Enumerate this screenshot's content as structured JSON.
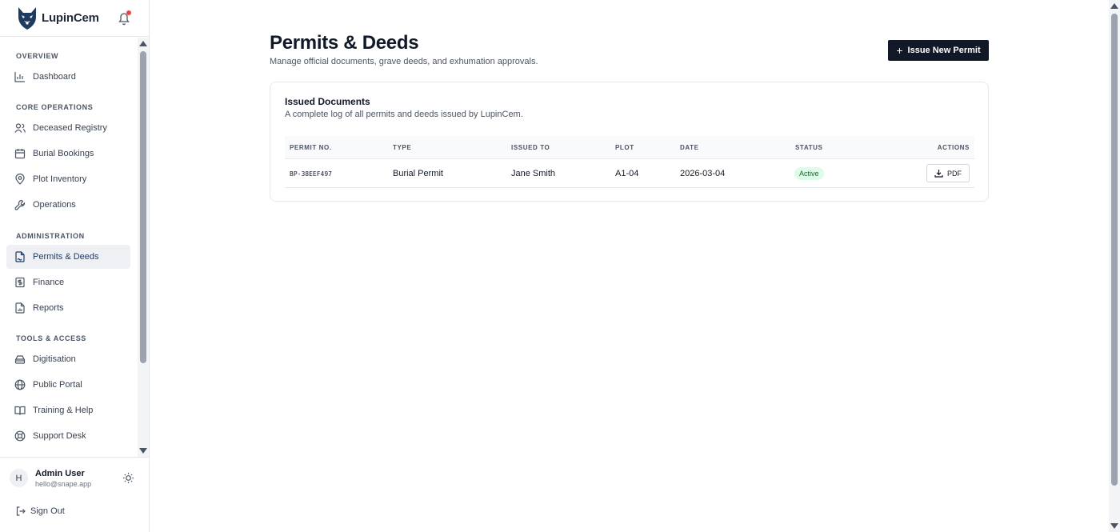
{
  "brand": {
    "name": "LupinCem"
  },
  "sidebar": {
    "sections": [
      {
        "title": "OVERVIEW",
        "items": [
          {
            "label": "Dashboard",
            "icon": "bar-chart-icon"
          }
        ]
      },
      {
        "title": "CORE OPERATIONS",
        "items": [
          {
            "label": "Deceased Registry",
            "icon": "users-icon"
          },
          {
            "label": "Burial Bookings",
            "icon": "calendar-icon"
          },
          {
            "label": "Plot Inventory",
            "icon": "map-pin-icon"
          },
          {
            "label": "Operations",
            "icon": "wrench-icon"
          }
        ]
      },
      {
        "title": "ADMINISTRATION",
        "items": [
          {
            "label": "Permits & Deeds",
            "icon": "file-signature-icon",
            "active": true
          },
          {
            "label": "Finance",
            "icon": "receipt-icon"
          },
          {
            "label": "Reports",
            "icon": "file-chart-icon"
          }
        ]
      },
      {
        "title": "TOOLS & ACCESS",
        "items": [
          {
            "label": "Digitisation",
            "icon": "scanner-icon"
          },
          {
            "label": "Public Portal",
            "icon": "globe-icon"
          },
          {
            "label": "Training & Help",
            "icon": "book-icon"
          },
          {
            "label": "Support Desk",
            "icon": "life-buoy-icon"
          }
        ]
      }
    ]
  },
  "user": {
    "initial": "H",
    "name": "Admin User",
    "email": "hello@snape.app"
  },
  "signout_label": "Sign Out",
  "page": {
    "title": "Permits & Deeds",
    "subtitle": "Manage official documents, grave deeds, and exhumation approvals.",
    "issue_button": "Issue New Permit"
  },
  "card": {
    "title": "Issued Documents",
    "subtitle": "A complete log of all permits and deeds issued by LupinCem."
  },
  "table": {
    "headers": [
      "PERMIT NO.",
      "TYPE",
      "ISSUED TO",
      "PLOT",
      "DATE",
      "STATUS",
      "ACTIONS"
    ],
    "rows": [
      {
        "permit_no": "BP-38EEF497",
        "type": "Burial Permit",
        "issued_to": "Jane Smith",
        "plot": "A1-04",
        "date": "2026-03-04",
        "status": "Active",
        "action": "PDF"
      }
    ]
  },
  "colors": {
    "primary": "#111827",
    "active_bg": "#eef0f4",
    "badge_bg": "#dcfce7",
    "badge_text": "#166534",
    "notification": "#ef4444"
  }
}
